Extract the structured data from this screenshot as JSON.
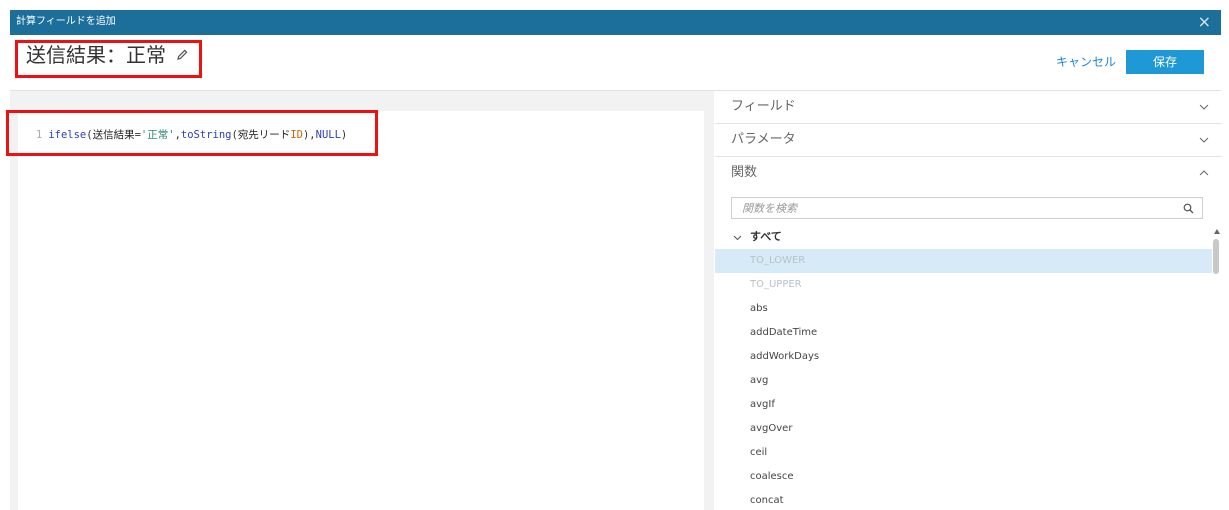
{
  "dialog": {
    "title": "計算フィールドを追加",
    "close_label": "×"
  },
  "header": {
    "field_name": "送信結果：正常",
    "cancel_label": "キャンセル",
    "save_label": "保存"
  },
  "editor": {
    "line_number": "1",
    "tokens": {
      "fn": "ifelse",
      "open": "(",
      "field": "送信結果",
      "eq": "=",
      "str": "'正常'",
      "comma1": ",",
      "fn2": "toString",
      "open2": "(",
      "field2": "宛先リード",
      "id": "ID",
      "close2": ")",
      "comma2": ",",
      "null": "NULL",
      "close": ")"
    }
  },
  "panel": {
    "sections": [
      {
        "label": "フィールド",
        "state": "collapsed"
      },
      {
        "label": "パラメータ",
        "state": "collapsed"
      },
      {
        "label": "関数",
        "state": "expanded"
      }
    ],
    "search_placeholder": "関数を検索",
    "all_label": "すべて",
    "functions": [
      "TO_LOWER",
      "TO_UPPER",
      "abs",
      "addDateTime",
      "addWorkDays",
      "avg",
      "avgIf",
      "avgOver",
      "ceil",
      "coalesce",
      "concat"
    ],
    "selected_function": "TO_LOWER"
  },
  "colors": {
    "titlebar": "#1c6f9a",
    "accent": "#1f99d6",
    "highlight_border": "#ee1111",
    "selected_row": "#d6ebf7"
  }
}
